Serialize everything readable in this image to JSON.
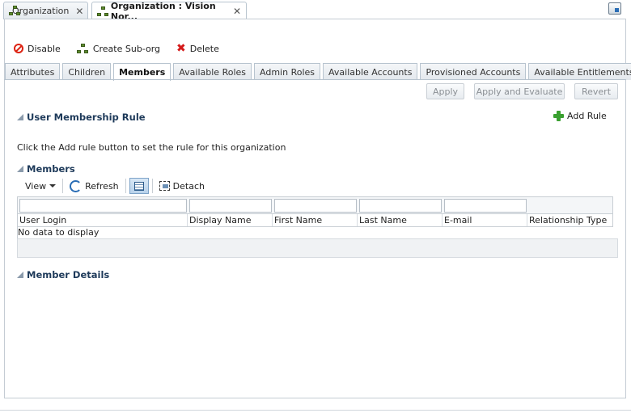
{
  "doc_tabs": [
    {
      "label": "Organization",
      "close": "✕",
      "active": false
    },
    {
      "label": "Organization : Vision Nor...",
      "close": "✕",
      "active": true
    }
  ],
  "toolbar": {
    "disable_label": "Disable",
    "create_suborg_label": "Create Sub-org",
    "delete_label": "Delete"
  },
  "sub_tabs": [
    {
      "label": "Attributes"
    },
    {
      "label": "Children"
    },
    {
      "label": "Members",
      "active": true
    },
    {
      "label": "Available Roles"
    },
    {
      "label": "Admin Roles"
    },
    {
      "label": "Available Accounts"
    },
    {
      "label": "Provisioned Accounts"
    },
    {
      "label": "Available Entitlements"
    }
  ],
  "buttons": {
    "apply": "Apply",
    "apply_evaluate": "Apply and Evaluate",
    "revert": "Revert"
  },
  "membership_rule": {
    "title": "User Membership Rule",
    "add_rule_label": "Add Rule",
    "hint": "Click the Add rule button to set the rule for this organization"
  },
  "members": {
    "title": "Members",
    "view_label": "View",
    "refresh_label": "Refresh",
    "detach_label": "Detach",
    "columns": [
      "User Login",
      "Display Name",
      "First Name",
      "Last Name",
      "E-mail",
      "Relationship Type"
    ],
    "empty_text": "No data to display"
  },
  "member_details": {
    "title": "Member Details"
  },
  "icons": {
    "org": "org-tree-icon",
    "disable": "disable-icon",
    "delete": "delete-icon",
    "add": "plus-icon",
    "refresh": "refresh-icon",
    "detach": "detach-icon"
  }
}
